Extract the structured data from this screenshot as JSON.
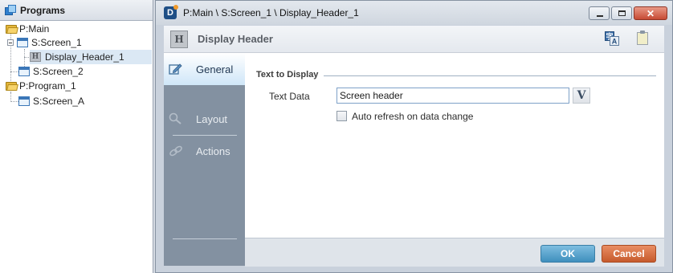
{
  "programs_panel": {
    "title": "Programs",
    "tree": [
      {
        "label": "P:Main",
        "icon": "folder-icon"
      },
      {
        "label": "S:Screen_1",
        "icon": "screen-icon"
      },
      {
        "label": "Display_Header_1",
        "icon": "display-header-icon",
        "selected": true
      },
      {
        "label": "S:Screen_2",
        "icon": "screen-icon"
      },
      {
        "label": "P:Program_1",
        "icon": "folder-icon"
      },
      {
        "label": "S:Screen_A",
        "icon": "screen-icon"
      }
    ]
  },
  "dialog": {
    "title": "P:Main \\ S:Screen_1 \\ Display_Header_1",
    "header_title": "Display Header",
    "header_icon_letter": "H",
    "tree_item_icon_letter": "H",
    "app_icon_letter": "D",
    "nav": [
      {
        "label": "General",
        "icon": "pencil-icon",
        "active": true
      },
      {
        "label": "Layout",
        "icon": "magnifier-icon"
      },
      {
        "label": "Actions",
        "icon": "link-icon"
      }
    ],
    "group_title": "Text to Display",
    "field_label": "Text Data",
    "text_value": "Screen header",
    "variable_button": "V",
    "checkbox_label": "Auto refresh on data change",
    "checkbox_checked": false,
    "ok_label": "OK",
    "cancel_label": "Cancel"
  },
  "colors": {
    "nav_background": "#8391a1",
    "ok_button": "#4f9cc8",
    "cancel_button": "#d46a3b",
    "selection": "#dbe8f4"
  }
}
